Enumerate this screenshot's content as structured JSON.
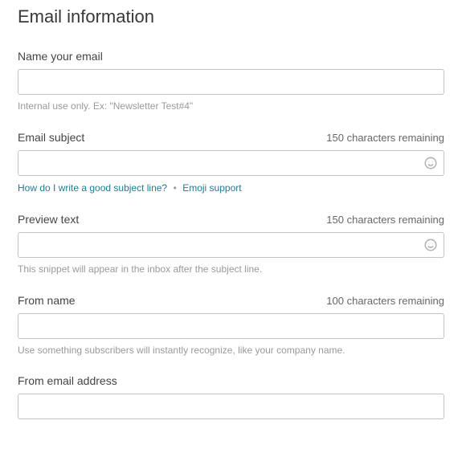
{
  "page": {
    "title": "Email information"
  },
  "fields": {
    "name": {
      "label": "Name your email",
      "value": "",
      "hint": "Internal use only. Ex: \"Newsletter Test#4\""
    },
    "subject": {
      "label": "Email subject",
      "value": "",
      "charRemaining": "150 characters remaining",
      "link1": "How do I write a good subject line?",
      "link2": "Emoji support",
      "linkSep": "•"
    },
    "preview": {
      "label": "Preview text",
      "value": "",
      "charRemaining": "150 characters remaining",
      "hint": "This snippet will appear in the inbox after the subject line."
    },
    "fromName": {
      "label": "From name",
      "value": "",
      "charRemaining": "100 characters remaining",
      "hint": "Use something subscribers will instantly recognize, like your company name."
    },
    "fromEmail": {
      "label": "From email address",
      "value": ""
    }
  }
}
